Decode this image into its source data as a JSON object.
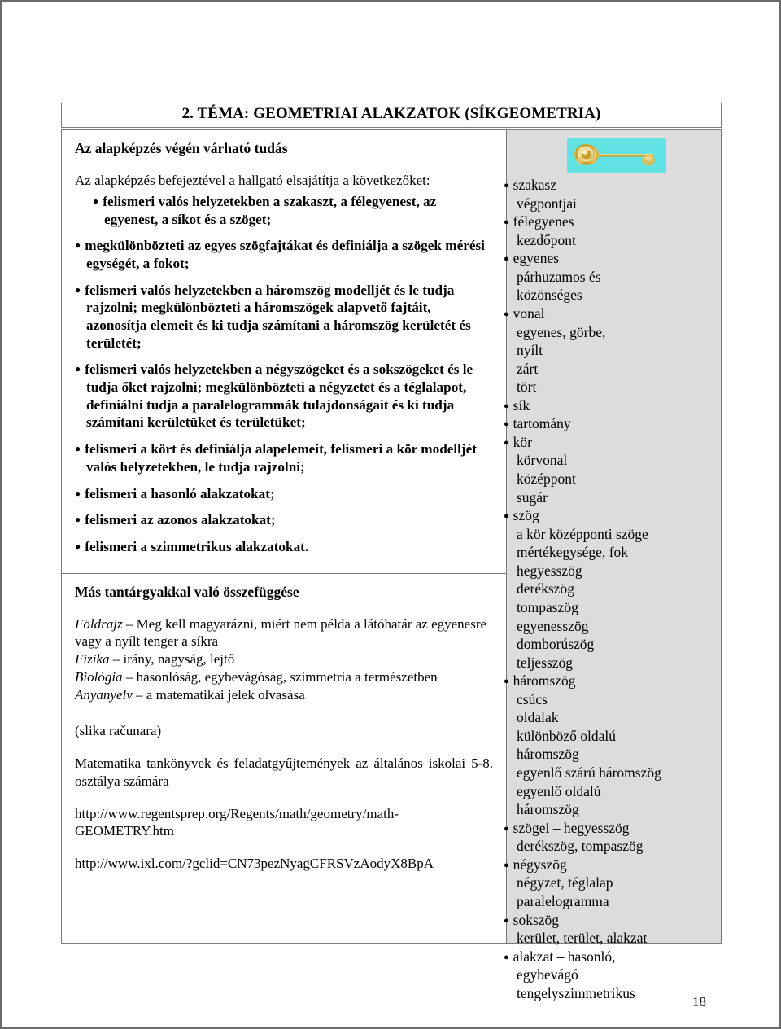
{
  "page": {
    "number": "18",
    "title": "2. TÉMA: GEOMETRIAI ALAKZATOK (SÍKGEOMETRIA)"
  },
  "colors": {
    "vocab_background": "#dcdcdc",
    "key_icon_background": "#62e2e2",
    "key_icon_gold": "#d4a82a",
    "border": "#7a7a7a",
    "text": "#000000"
  },
  "left_column": {
    "outcomes": {
      "heading": "Az alapképzés végén várható tudás",
      "intro": "Az alapképzés befejeztével a hallgató elsajátítja a következőket:",
      "items": [
        "felismeri valós helyzetekben a szakaszt, a félegyenest, az egyenest, a síkot és a szöget;",
        "megkülönbözteti az egyes szögfajtákat és definiálja a szögek mérési egységét, a fokot;",
        "felismeri valós helyzetekben a háromszög modelljét és le tudja rajzolni; megkülönbözteti a háromszögek alapvető fajtáit, azonosítja elemeit és ki tudja számítani a háromszög kerületét és területét;",
        "felismeri valós helyzetekben a négyszögeket és a sokszögeket és le tudja őket rajzolni; megkülönbözteti a négyzetet és a téglalapot, definiálni tudja a paralelogrammák tulajdonságait és ki tudja számítani kerületüket és területüket;",
        "felismeri a kört és definiálja alapelemeit, felismeri a kör modelljét valós helyzetekben, le tudja rajzolni;",
        "felismeri a hasonló alakzatokat;",
        "felismeri az azonos alakzatokat;",
        "felismeri a szimmetrikus alakzatokat."
      ]
    },
    "interdisciplinary": {
      "heading": "Más tantárgyakkal való összefüggése",
      "lines": [
        {
          "subject": "Földrajz",
          "dash": " – ",
          "text": "Meg kell magyarázni, miért nem példa a látóhatár az egyenesre vagy a nyílt tenger a síkra"
        },
        {
          "subject": "Fizika",
          "dash": " – ",
          "text": "irány, nagyság, lejtő"
        },
        {
          "subject": "Biológia",
          "dash": " – ",
          "text": "hasonlóság, egybevágóság, szimmetria a természetben"
        },
        {
          "subject": "Anyanyelv",
          "dash": " – ",
          "text": "a matematikai jelek olvasása"
        }
      ]
    },
    "resources": {
      "note": "(slika računara)",
      "textbooks": "Matematika tankönyvek és feladatgyűjtemények az általános iskolai 5-8. osztálya számára",
      "link1": "http://www.regentsprep.org/Regents/math/geometry/math-GEOMETRY.htm",
      "link2": "http://www.ixl.com/?gclid=CN73pezNyagCFRSVzAodyX8BpA"
    }
  },
  "right_column": {
    "icon_name": "key-icon",
    "vocabulary": [
      {
        "type": "bullet",
        "text": "szakasz"
      },
      {
        "type": "sub",
        "text": "végpontjai"
      },
      {
        "type": "bullet",
        "text": "félegyenes"
      },
      {
        "type": "sub",
        "text": "kezdőpont"
      },
      {
        "type": "bullet",
        "text": "egyenes"
      },
      {
        "type": "sub",
        "text": "párhuzamos és"
      },
      {
        "type": "sub",
        "text": "közönséges"
      },
      {
        "type": "bullet",
        "text": "vonal"
      },
      {
        "type": "sub",
        "text": "egyenes, görbe,"
      },
      {
        "type": "sub",
        "text": "nyílt"
      },
      {
        "type": "sub",
        "text": "zárt"
      },
      {
        "type": "sub",
        "text": "tört"
      },
      {
        "type": "bullet",
        "text": "sík"
      },
      {
        "type": "bullet",
        "text": "tartomány"
      },
      {
        "type": "bullet",
        "text": "kör"
      },
      {
        "type": "sub",
        "text": "körvonal"
      },
      {
        "type": "sub",
        "text": "középpont"
      },
      {
        "type": "sub",
        "text": "sugár"
      },
      {
        "type": "bullet",
        "text": "szög"
      },
      {
        "type": "sub",
        "text": "a kör középponti szöge"
      },
      {
        "type": "sub",
        "text": "mértékegysége, fok"
      },
      {
        "type": "sub",
        "text": "hegyesszög"
      },
      {
        "type": "sub",
        "text": "derékszög"
      },
      {
        "type": "sub",
        "text": "tompaszög"
      },
      {
        "type": "sub",
        "text": "egyenesszög"
      },
      {
        "type": "sub",
        "text": "domborúszög"
      },
      {
        "type": "sub",
        "text": "teljesszög"
      },
      {
        "type": "bullet",
        "text": "háromszög"
      },
      {
        "type": "sub",
        "text": "csúcs"
      },
      {
        "type": "sub",
        "text": "oldalak"
      },
      {
        "type": "sub",
        "text": "különböző oldalú"
      },
      {
        "type": "sub2",
        "text": "háromszög"
      },
      {
        "type": "sub",
        "text": "egyenlő szárú háromszög"
      },
      {
        "type": "sub",
        "text": "egyenlő oldalú"
      },
      {
        "type": "sub2",
        "text": "háromszög"
      },
      {
        "type": "bullet",
        "text": "szögei – hegyesszög"
      },
      {
        "type": "sub",
        "text": "derékszög, tompaszög"
      },
      {
        "type": "bullet",
        "text": "négyszög"
      },
      {
        "type": "sub",
        "text": "négyzet, téglalap"
      },
      {
        "type": "sub",
        "text": "paralelogramma"
      },
      {
        "type": "bullet",
        "text": "sokszög"
      },
      {
        "type": "sub",
        "text": "kerület, terület, alakzat"
      },
      {
        "type": "bullet",
        "text": "alakzat – hasonló,"
      },
      {
        "type": "flat",
        "text": "egybevágó"
      },
      {
        "type": "flat",
        "text": "tengelyszimmetrikus"
      }
    ]
  }
}
